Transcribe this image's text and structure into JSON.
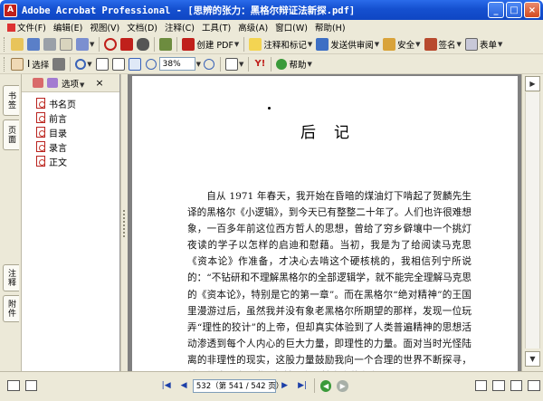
{
  "window": {
    "title": "Adobe Acrobat Professional - [思辨的张力：黑格尔辩证法新探.pdf]",
    "controls": [
      "_",
      "□",
      "×"
    ]
  },
  "menu": [
    {
      "label": "文件(F)"
    },
    {
      "label": "编辑(E)"
    },
    {
      "label": "视图(V)"
    },
    {
      "label": "文档(D)"
    },
    {
      "label": "注释(C)"
    },
    {
      "label": "工具(T)"
    },
    {
      "label": "高级(A)"
    },
    {
      "label": "窗口(W)"
    },
    {
      "label": "帮助(H)"
    }
  ],
  "toolbar1": {
    "create_pdf": "创建 PDF",
    "comment_markup": "注释和标记",
    "send_review": "发送供审阅",
    "secure": "安全",
    "sign": "签名",
    "forms": "表单"
  },
  "toolbar2": {
    "select": "选择",
    "zoom_value": "38%",
    "help": "帮助"
  },
  "left_tabs": {
    "bookmarks": "书签",
    "pages": "页面",
    "comments": "注释",
    "attachments": "附件"
  },
  "panel": {
    "options_label": "选项",
    "close": "×",
    "bookmarks": [
      {
        "label": "书名页"
      },
      {
        "label": "前言"
      },
      {
        "label": "目录"
      },
      {
        "label": "录言"
      },
      {
        "label": "正文"
      }
    ]
  },
  "document": {
    "page_title": "后记",
    "body": "自从 1971 年春天，我开始在昏暗的煤油灯下啃起了贺麟先生译的黑格尔《小逻辑》，到今天已有整整二十年了。人们也许很难想象，一百多年前这位西方哲人的思想，曾给了穷乡僻壤中一个挑灯夜读的学子以怎样的启迪和慰藉。当初，我是为了给阅读马克思《资本论》作准备，才决心去啃这个硬核桃的，我相信列宁所说的：“不钻研和不理解黑格尔的全部逻辑学，就不能完全理解马克思的《资本论》，特别是它的第一章”。而在黑格尔“绝对精神”的王国里漫游过后，虽然我并没有象老黑格尔所期望的那样，发现一位玩弄“理性的狡计”的上帝，但却真实体验到了人类普遍精神的思想活动渗透到每个人内心的巨大力量，即理性的力量。面对当时光怪陆离的非理性的现实，这股力量鼓励我向一个合理的世界不断探寻，并坚信这个合理世界超越于有限性之上的存在。"
  },
  "status": {
    "page_indicator": "532（第 541 / 542 页）"
  },
  "colors": {
    "title_bar": "#1550d0",
    "chrome": "#ece9d8",
    "doc_background": "#808080",
    "pdf_red": "#c0201b"
  }
}
